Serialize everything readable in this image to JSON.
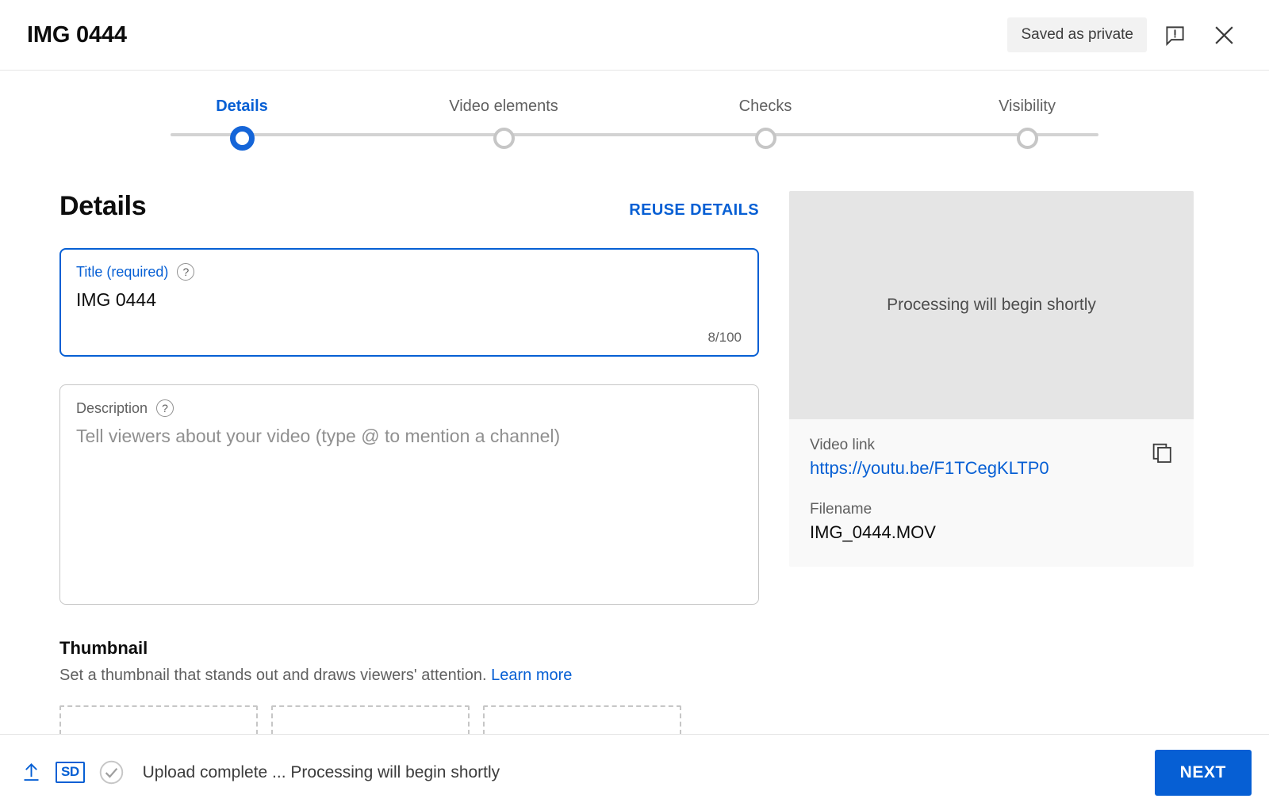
{
  "header": {
    "title": "IMG 0444",
    "status_badge": "Saved as private",
    "feedback_icon": "feedback-exclamation-icon",
    "close_icon": "close-icon"
  },
  "stepper": {
    "steps": [
      {
        "label": "Details",
        "state": "active"
      },
      {
        "label": "Video elements",
        "state": "inactive"
      },
      {
        "label": "Checks",
        "state": "inactive"
      },
      {
        "label": "Visibility",
        "state": "inactive"
      }
    ]
  },
  "details": {
    "section_title": "Details",
    "reuse_label": "REUSE DETAILS",
    "title_field": {
      "label": "Title (required)",
      "value": "IMG 0444",
      "char_count": "8/100",
      "help_icon": "help-circle-icon"
    },
    "description_field": {
      "label": "Description",
      "placeholder": "Tell viewers about your video (type @ to mention a channel)",
      "value": "",
      "help_icon": "help-circle-icon"
    }
  },
  "thumbnail": {
    "title": "Thumbnail",
    "description": "Set a thumbnail that stands out and draws viewers' attention.",
    "learn_more": "Learn more"
  },
  "preview": {
    "processing_text": "Processing will begin shortly",
    "video_link_label": "Video link",
    "video_link": "https://youtu.be/F1TCegKLTP0",
    "filename_label": "Filename",
    "filename": "IMG_0444.MOV",
    "copy_icon": "copy-icon"
  },
  "footer": {
    "upload_icon": "upload-arrow-icon",
    "quality_badge": "SD",
    "check_icon": "check-circle-icon",
    "status": "Upload complete ... Processing will begin shortly",
    "next_label": "NEXT"
  },
  "colors": {
    "accent": "#065fd4",
    "active_step": "#1565d8",
    "text_primary": "#0d0d0d",
    "text_secondary": "#606060",
    "panel_bg": "#f9f9f9",
    "video_bg": "#e5e5e5"
  }
}
